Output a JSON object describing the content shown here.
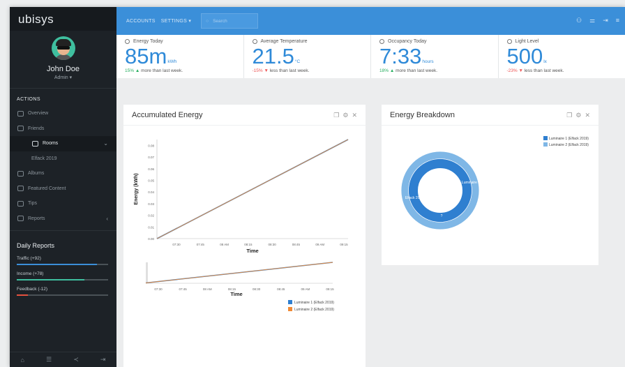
{
  "brand": "ubisys",
  "user": {
    "name": "John Doe",
    "role": "Admin ▾"
  },
  "sidebar": {
    "section_title": "ACTIONS",
    "items": [
      {
        "label": "Overview",
        "icon": "monitor-icon"
      },
      {
        "label": "Friends",
        "icon": "users-icon"
      },
      {
        "label": "Rooms",
        "icon": "grid-icon",
        "active": true
      },
      {
        "label": "Elfack 2019",
        "icon": ""
      },
      {
        "label": "Albums",
        "icon": "album-icon"
      },
      {
        "label": "Featured Content",
        "icon": "grid-icon"
      },
      {
        "label": "Tips",
        "icon": "lifebuoy-icon"
      },
      {
        "label": "Reports",
        "icon": "chat-icon"
      }
    ],
    "daily_title": "Daily Reports",
    "reports": [
      {
        "label": "Traffic (+92)",
        "value": 0.88,
        "color": "#3b8fd9"
      },
      {
        "label": "Income (+78)",
        "value": 0.74,
        "color": "#3fbf9f"
      },
      {
        "label": "Feedback (-12)",
        "value": 0.12,
        "color": "#e5523f"
      }
    ]
  },
  "topbar": {
    "accounts": "ACCOUNTS",
    "settings": "SETTINGS ▾",
    "search_placeholder": "Search"
  },
  "stats": [
    {
      "title": "Energy Today",
      "icon": "user-icon",
      "value": "85m",
      "unit": "kWh",
      "pct": "15%",
      "dir": "up",
      "text": "more than last week."
    },
    {
      "title": "Average Temperature",
      "icon": "share-icon",
      "value": "21.5",
      "unit": "°C",
      "pct": "-15%",
      "dir": "down",
      "text": "less than last week."
    },
    {
      "title": "Occupancy Today",
      "icon": "clock-icon",
      "value": "7:33",
      "unit": "hours",
      "pct": "18%",
      "dir": "up",
      "text": "more than last week."
    },
    {
      "title": "Light Level",
      "icon": "search-icon",
      "value": "500",
      "unit": "lx",
      "pct": "-23%",
      "dir": "down",
      "text": "less than last week."
    }
  ],
  "energy_panel": {
    "title": "Accumulated Energy"
  },
  "breakdown_panel": {
    "title": "Energy Breakdown"
  },
  "chart_data": [
    {
      "type": "line",
      "title": "",
      "xlabel": "Time",
      "ylabel": "Energy (kWh)",
      "x_ticks": [
        "07:30",
        "07:45",
        "08 AM",
        "08:15",
        "08:30",
        "08:45",
        "09 AM",
        "09:15"
      ],
      "y_ticks": [
        "0.00",
        "0.01",
        "0.02",
        "0.03",
        "0.04",
        "0.05",
        "0.06",
        "0.07",
        "0.08"
      ],
      "ylim": [
        0,
        0.085
      ],
      "series": [
        {
          "name": "Luminaire 1 (Elfack 2019)",
          "color": "#2f7fd0",
          "x": [
            0,
            1
          ],
          "values": [
            0.0,
            0.085
          ]
        },
        {
          "name": "Luminaire 2 (Elfack 2019)",
          "color": "#f08a35",
          "x": [
            0,
            1
          ],
          "values": [
            0.0,
            0.085
          ]
        }
      ]
    },
    {
      "type": "line",
      "title": "",
      "xlabel": "Time",
      "x_ticks": [
        "07:30",
        "07:45",
        "08 AM",
        "08:15",
        "08:30",
        "08:45",
        "09 AM",
        "09:15"
      ],
      "series": [
        {
          "name": "Luminaire 1 (Elfack 2019)",
          "color": "#2f7fd0"
        },
        {
          "name": "Luminaire 2 (Elfack 2019)",
          "color": "#f08a35"
        }
      ]
    },
    {
      "type": "pie",
      "title": "",
      "legend": [
        "Luminaire 1 (Elfack 2019)",
        "Luminaire 2 (Elfack 2019)"
      ],
      "legend_position": "top-right",
      "rings": [
        {
          "series": "Luminaire 2 (Elfack 2019)",
          "color": "#7fb7e6",
          "values": [
            1
          ]
        },
        {
          "series": "Luminaire 1 (Elfack 2019)",
          "color": "#2f7fd0",
          "values": [
            1
          ]
        }
      ],
      "labels": [
        "Luminaire 1",
        "Elfack 2019",
        "?"
      ]
    }
  ]
}
